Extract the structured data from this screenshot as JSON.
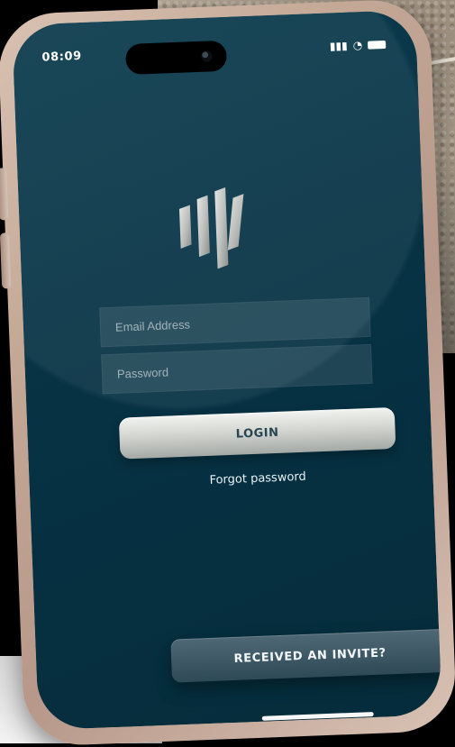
{
  "status_bar": {
    "time": "08:09",
    "icons": [
      "cellular-signal-icon",
      "wifi-icon",
      "battery-icon"
    ]
  },
  "login_form": {
    "email_placeholder": "Email Address",
    "email_value": "",
    "password_placeholder": "Password",
    "password_value": "",
    "login_label": "LOGIN",
    "forgot_password_label": "Forgot password"
  },
  "invite": {
    "label": "RECEIVED AN INVITE?"
  },
  "colors": {
    "screen_bg": "#073345",
    "login_button_top": "#f2f3f0",
    "invite_button": "#2f4a57"
  }
}
